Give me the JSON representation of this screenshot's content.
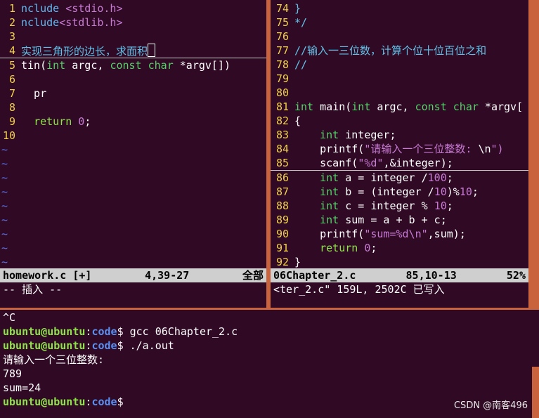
{
  "left_pane": {
    "lines": [
      {
        "n": "1",
        "segs": [
          {
            "t": "nclude ",
            "c": "inc"
          },
          {
            "t": "<stdio.h>",
            "c": "str"
          }
        ]
      },
      {
        "n": "2",
        "segs": [
          {
            "t": "nclude",
            "c": "inc"
          },
          {
            "t": "<stdlib.h>",
            "c": "str"
          }
        ]
      },
      {
        "n": "3",
        "segs": []
      },
      {
        "n": "4",
        "segs": [
          {
            "t": "实现三角形的边长，求面积",
            "c": "cmt"
          }
        ],
        "cursor": true
      },
      {
        "n": "5",
        "segs": [
          {
            "t": "tin(",
            "c": ""
          },
          {
            "t": "int",
            "c": "ty"
          },
          {
            "t": " argc, ",
            "c": ""
          },
          {
            "t": "const char",
            "c": "ty"
          },
          {
            "t": " *argv[])",
            "c": ""
          }
        ]
      },
      {
        "n": "6",
        "segs": []
      },
      {
        "n": "7",
        "segs": [
          {
            "t": "  pr",
            "c": ""
          }
        ]
      },
      {
        "n": "8",
        "segs": []
      },
      {
        "n": "9",
        "segs": [
          {
            "t": "  ",
            "c": ""
          },
          {
            "t": "return",
            "c": "kw"
          },
          {
            "t": " ",
            "c": ""
          },
          {
            "t": "0",
            "c": "num"
          },
          {
            "t": ";",
            "c": ""
          }
        ]
      },
      {
        "n": "10",
        "segs": []
      }
    ],
    "tildes": 9,
    "status_file": "homework.c [+]",
    "status_pos": "4,39-27",
    "status_scroll": "全部",
    "mode_msg": "-- 插入 --"
  },
  "right_pane": {
    "lines": [
      {
        "n": "74",
        "segs": [
          {
            "t": "}",
            "c": "cmt"
          }
        ]
      },
      {
        "n": "75",
        "segs": [
          {
            "t": "*/",
            "c": "cmt"
          }
        ]
      },
      {
        "n": "76",
        "segs": []
      },
      {
        "n": "77",
        "segs": [
          {
            "t": "//输入一三位数，计算个位十位百位之和",
            "c": "cmt"
          }
        ]
      },
      {
        "n": "78",
        "segs": [
          {
            "t": "//",
            "c": "cmt"
          }
        ]
      },
      {
        "n": "79",
        "segs": []
      },
      {
        "n": "80",
        "segs": []
      },
      {
        "n": "81",
        "segs": [
          {
            "t": "int",
            "c": "ty"
          },
          {
            "t": " main(",
            "c": ""
          },
          {
            "t": "int",
            "c": "ty"
          },
          {
            "t": " argc, ",
            "c": ""
          },
          {
            "t": "const char",
            "c": "ty"
          },
          {
            "t": " *argv[",
            "c": ""
          }
        ]
      },
      {
        "n": "82",
        "segs": [
          {
            "t": "{",
            "c": ""
          }
        ]
      },
      {
        "n": "83",
        "segs": [
          {
            "t": "    ",
            "c": ""
          },
          {
            "t": "int",
            "c": "ty"
          },
          {
            "t": " integer;",
            "c": ""
          }
        ]
      },
      {
        "n": "84",
        "segs": [
          {
            "t": "    printf(",
            "c": ""
          },
          {
            "t": "\"请输入一个三位整数: ",
            "c": "str"
          },
          {
            "t": "\\n",
            "c": ""
          },
          {
            "t": "\")",
            "c": "str"
          }
        ]
      },
      {
        "n": "85",
        "segs": [
          {
            "t": "    scanf(",
            "c": ""
          },
          {
            "t": "\"%d\"",
            "c": "str"
          },
          {
            "t": ",&integer);",
            "c": ""
          }
        ],
        "cursor": true
      },
      {
        "n": "86",
        "segs": [
          {
            "t": "    ",
            "c": ""
          },
          {
            "t": "int",
            "c": "ty"
          },
          {
            "t": " a = integer /",
            "c": ""
          },
          {
            "t": "100",
            "c": "num"
          },
          {
            "t": ";",
            "c": ""
          }
        ]
      },
      {
        "n": "87",
        "segs": [
          {
            "t": "    ",
            "c": ""
          },
          {
            "t": "int",
            "c": "ty"
          },
          {
            "t": " b = (integer /",
            "c": ""
          },
          {
            "t": "10",
            "c": "num"
          },
          {
            "t": ")%",
            "c": ""
          },
          {
            "t": "10",
            "c": "num"
          },
          {
            "t": ";",
            "c": ""
          }
        ]
      },
      {
        "n": "88",
        "segs": [
          {
            "t": "    ",
            "c": ""
          },
          {
            "t": "int",
            "c": "ty"
          },
          {
            "t": " c = integer % ",
            "c": ""
          },
          {
            "t": "10",
            "c": "num"
          },
          {
            "t": ";",
            "c": ""
          }
        ]
      },
      {
        "n": "89",
        "segs": [
          {
            "t": "    ",
            "c": ""
          },
          {
            "t": "int",
            "c": "ty"
          },
          {
            "t": " sum = a + b + c;",
            "c": ""
          }
        ]
      },
      {
        "n": "90",
        "segs": [
          {
            "t": "    printf(",
            "c": ""
          },
          {
            "t": "\"sum=%d\\n\"",
            "c": "str"
          },
          {
            "t": ",sum);",
            "c": ""
          }
        ]
      },
      {
        "n": "91",
        "segs": [
          {
            "t": "    ",
            "c": ""
          },
          {
            "t": "return",
            "c": "kw"
          },
          {
            "t": " ",
            "c": ""
          },
          {
            "t": "0",
            "c": "num"
          },
          {
            "t": ";",
            "c": ""
          }
        ]
      },
      {
        "n": "92",
        "segs": [
          {
            "t": "}",
            "c": ""
          }
        ]
      }
    ],
    "status_file": "06Chapter_2.c",
    "status_pos": "85,10-13",
    "status_scroll": "52%",
    "msg": "<ter_2.c\" 159L, 2502C 已写入"
  },
  "terminal": {
    "lines": [
      {
        "plain": "^C"
      },
      {
        "user": "ubuntu@ubuntu",
        "path": "code",
        "cmd": "$ gcc 06Chapter_2.c"
      },
      {
        "user": "ubuntu@ubuntu",
        "path": "code",
        "cmd": "$ ./a.out"
      },
      {
        "plain": "请输入一个三位整数:"
      },
      {
        "plain": "789"
      },
      {
        "plain": "sum=24"
      },
      {
        "user": "ubuntu@ubuntu",
        "path": "code",
        "cmd": "$"
      }
    ]
  },
  "watermark": "CSDN @南客496",
  "colors": {
    "background": "#300a24",
    "accent": "#c8633e",
    "status_bar": "#cfcfcf"
  }
}
